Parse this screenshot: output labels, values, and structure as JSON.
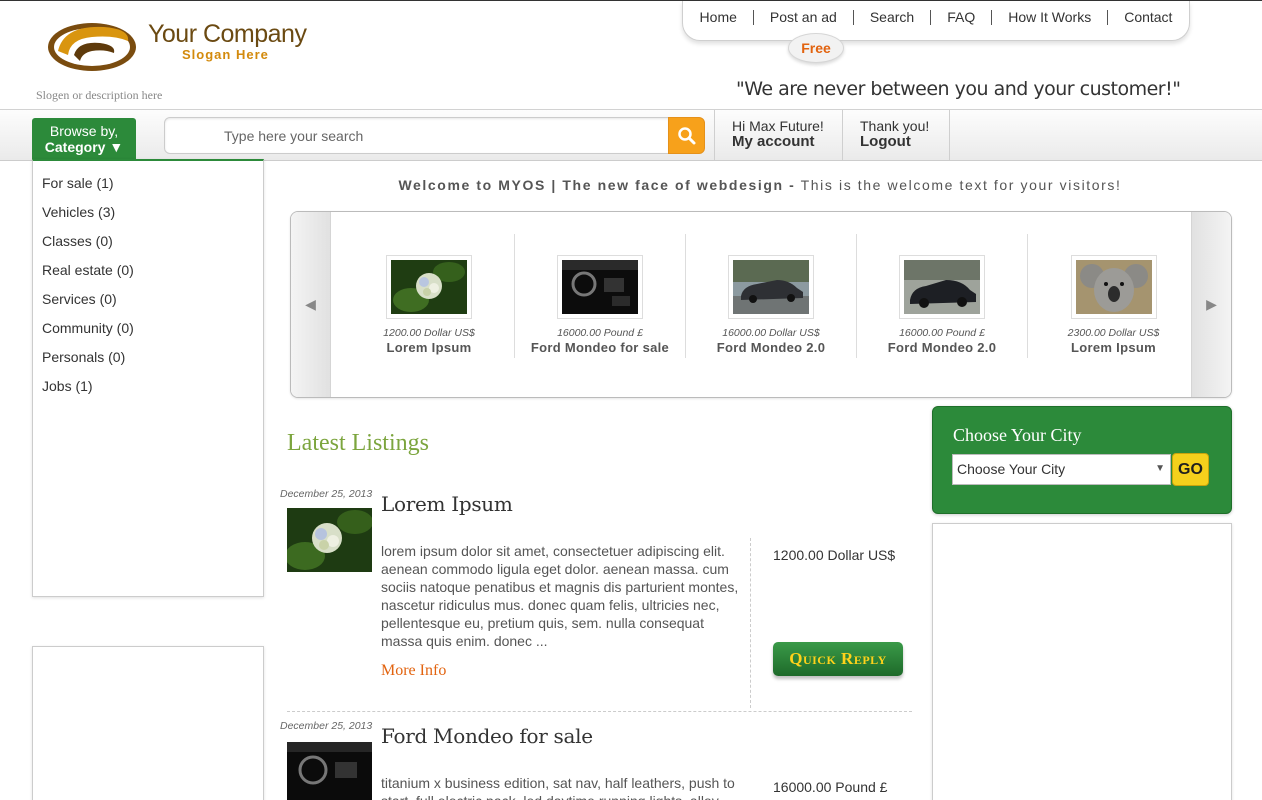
{
  "header": {
    "company_name": "Your Company",
    "slogan": "Slogan Here",
    "description": "Slogen or description here",
    "quote": "\"We are never between you and your customer!\"",
    "free_badge": "Free",
    "nav": [
      "Home",
      "Post an ad",
      "Search",
      "FAQ",
      "How It Works",
      "Contact"
    ]
  },
  "toolbar": {
    "browse_line1": "Browse by,",
    "browse_line2": "Category ▼",
    "search_placeholder": "Type here your search",
    "search_icon": "magnifier-icon",
    "greeting": "Hi Max Future!",
    "account_label": "My account",
    "thanks": "Thank you!",
    "logout_label": "Logout"
  },
  "categories": [
    "For sale (1)",
    "Vehicles (3)",
    "Classes (0)",
    "Real estate (0)",
    "Services (0)",
    "Community (0)",
    "Personals (0)",
    "Jobs (1)"
  ],
  "welcome": {
    "bold": "Welcome to MYOS | The new face of webdesign -",
    "normal": " This is the welcome text for your visitors!"
  },
  "carousel": {
    "items": [
      {
        "price": "1200.00 Dollar US$",
        "title": "Lorem Ipsum",
        "image": "flower"
      },
      {
        "price": "16000.00 Pound £",
        "title": "Ford Mondeo for sale",
        "image": "dashboard"
      },
      {
        "price": "16000.00 Dollar US$",
        "title": "Ford Mondeo 2.0",
        "image": "car"
      },
      {
        "price": "16000.00 Pound £",
        "title": "Ford Mondeo 2.0",
        "image": "car"
      },
      {
        "price": "2300.00 Dollar US$",
        "title": "Lorem Ipsum",
        "image": "koala"
      }
    ]
  },
  "latest": {
    "heading": "Latest Listings",
    "listings": [
      {
        "date": "December 25, 2013",
        "title": "Lorem Ipsum",
        "description": "lorem ipsum dolor sit amet, consectetuer adipiscing elit. aenean commodo ligula eget dolor. aenean massa. cum sociis natoque penatibus et magnis dis parturient montes, nascetur ridiculus mus. donec quam felis, ultricies nec, pellentesque eu, pretium quis, sem. nulla consequat massa quis enim. donec ...",
        "more": "More Info",
        "price": "1200.00 Dollar US$",
        "reply": "Quick Reply"
      },
      {
        "date": "December 25, 2013",
        "title": "Ford Mondeo for sale",
        "description": "titanium x business edition, sat nav, half leathers, push to start, full electric pack, led daytime running lights, alloy",
        "price": "16000.00 Pound £"
      }
    ]
  },
  "city": {
    "title": "Choose Your City",
    "selected": "Choose Your City",
    "go": "GO"
  }
}
